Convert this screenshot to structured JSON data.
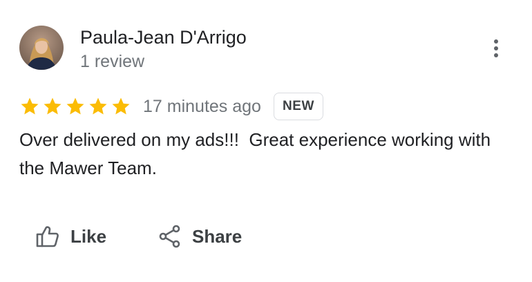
{
  "review": {
    "author_name": "Paula-Jean D'Arrigo",
    "author_review_count": "1 review",
    "rating": 5,
    "rating_max": 5,
    "time_ago": "17 minutes ago",
    "badge": "NEW",
    "text": "Over delivered on my ads!!!  Great experience working with the Mawer Team."
  },
  "actions": {
    "like_label": "Like",
    "share_label": "Share"
  },
  "icons": {
    "more": "more-vert-icon",
    "like": "thumb-up-icon",
    "share": "share-icon",
    "star": "star-icon"
  },
  "colors": {
    "star": "#fbbc04",
    "name": "#202124",
    "secondary_text": "#70757a",
    "action_text": "#3c4043",
    "badge_border": "#dadce0"
  }
}
